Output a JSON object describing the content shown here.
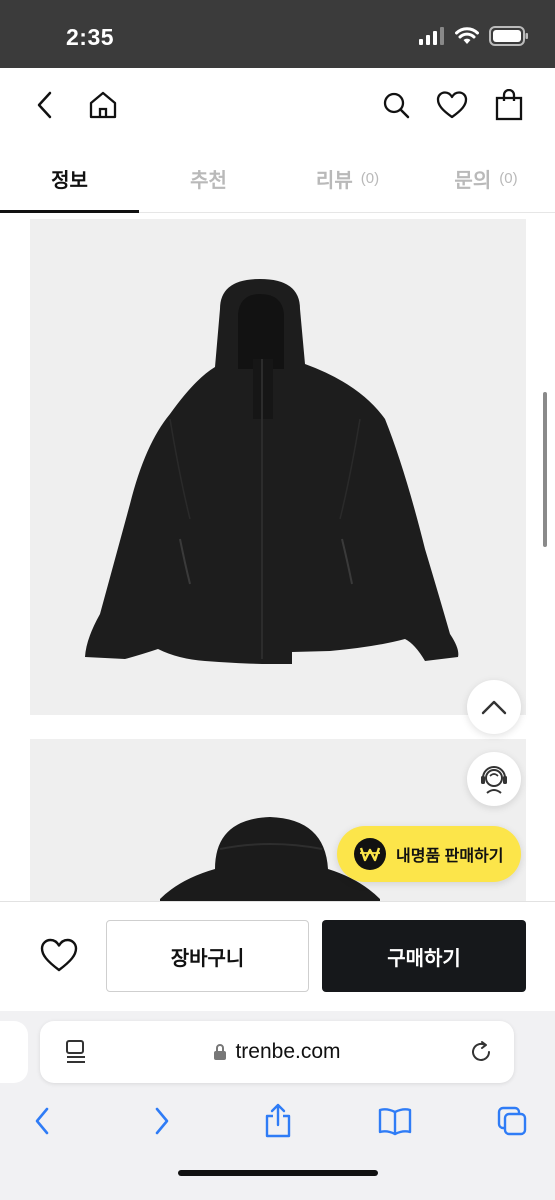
{
  "status_bar": {
    "time": "2:35"
  },
  "tabs": [
    {
      "label": "정보",
      "count": ""
    },
    {
      "label": "추천",
      "count": ""
    },
    {
      "label": "리뷰",
      "count": "(0)"
    },
    {
      "label": "문의",
      "count": "(0)"
    }
  ],
  "floating": {
    "sell_label": "내명품 판매하기"
  },
  "actions": {
    "cart_label": "장바구니",
    "buy_label": "구매하기"
  },
  "browser": {
    "url": "trenbe.com"
  },
  "colors": {
    "sell_button": "#fce54a",
    "buy_button": "#16181b",
    "safari_blue": "#2f7cf6"
  }
}
